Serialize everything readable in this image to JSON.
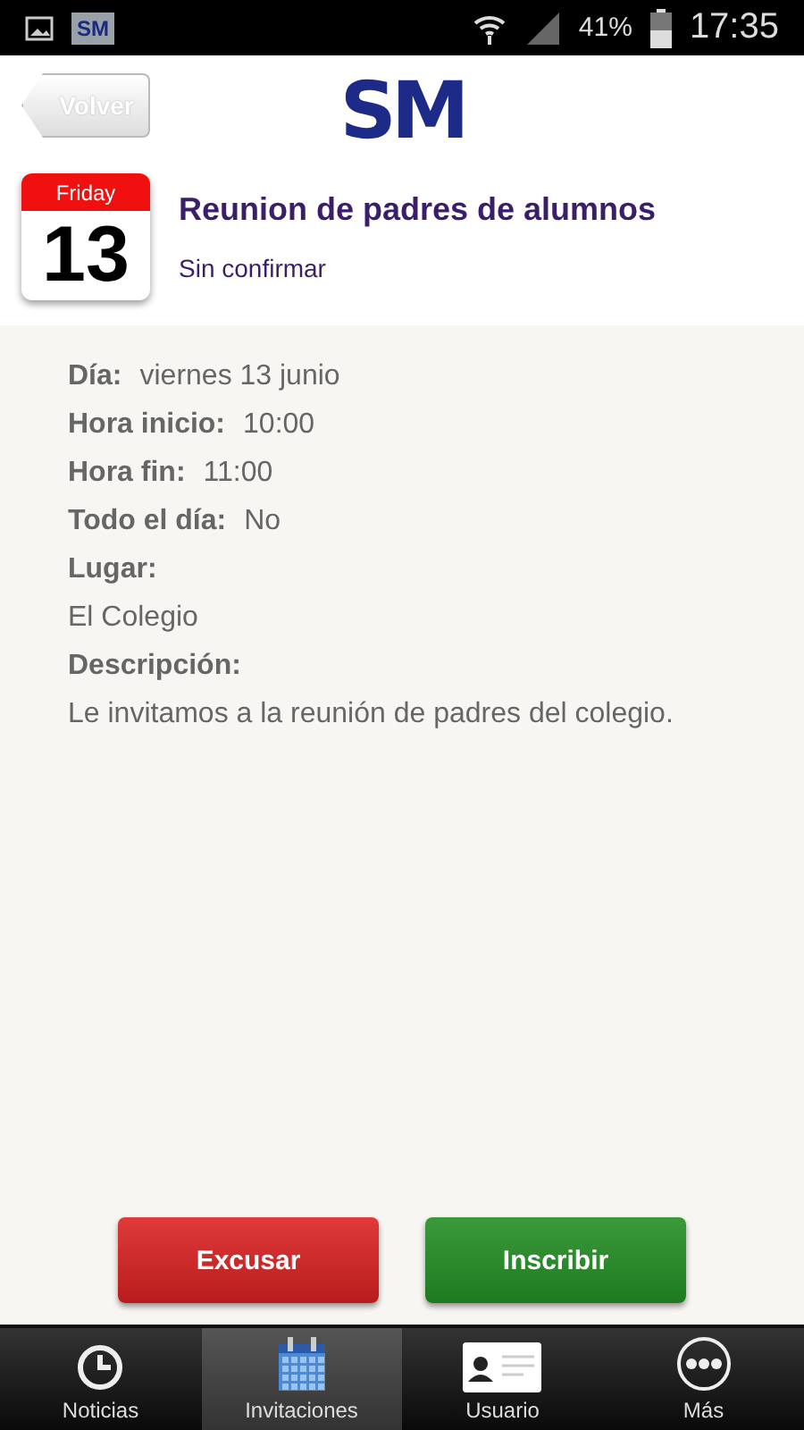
{
  "status_bar": {
    "app_badge": "SM",
    "battery": "41%",
    "time": "17:35"
  },
  "header": {
    "back_button": "Volver",
    "logo": "SM"
  },
  "event": {
    "weekday": "Friday",
    "day": "13",
    "title": "Reunion de padres de alumnos",
    "status": "Sin confirmar"
  },
  "details": [
    {
      "kind": "inline",
      "label": "Día:",
      "value": "viernes 13 junio"
    },
    {
      "kind": "inline",
      "label": "Hora inicio:",
      "value": "10:00"
    },
    {
      "kind": "inline",
      "label": "Hora fin:",
      "value": "11:00"
    },
    {
      "kind": "inline",
      "label": "Todo el día:",
      "value": "No"
    },
    {
      "kind": "block",
      "label": "Lugar:",
      "value": "El Colegio"
    },
    {
      "kind": "block",
      "label": "Descripción:",
      "value": "Le invitamos a la reunión de padres del colegio."
    }
  ],
  "actions": [
    {
      "kind": "decline",
      "label": "Excusar"
    },
    {
      "kind": "accept",
      "label": "Inscribir"
    }
  ],
  "tabs": [
    {
      "kind": "clock",
      "label": "Noticias",
      "selected": false
    },
    {
      "kind": "calendar",
      "label": "Invitaciones",
      "selected": true
    },
    {
      "kind": "card",
      "label": "Usuario",
      "selected": false
    },
    {
      "kind": "more",
      "label": "Más",
      "selected": false
    }
  ]
}
